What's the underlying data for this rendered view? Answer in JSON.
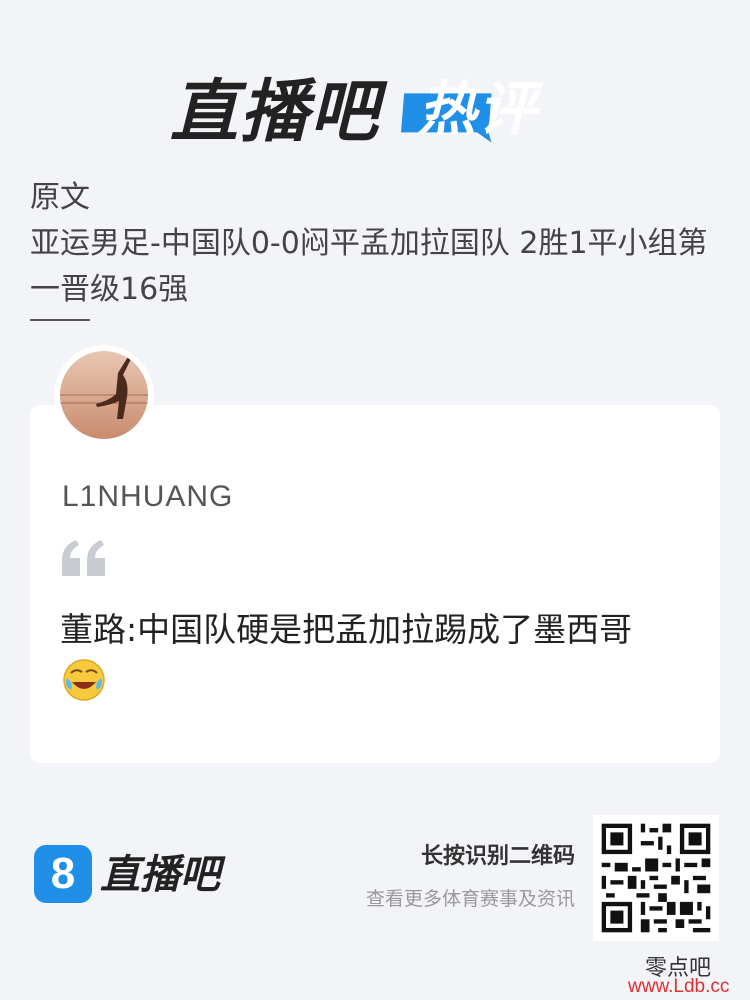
{
  "header": {
    "logo_text": "直播吧",
    "badge_text": "热评",
    "brand_blue": "#1f8fe8"
  },
  "original": {
    "title": "原文",
    "body": "亚运男足-中国队0-0闷平孟加拉国队 2胜1平小组第一晋级16强"
  },
  "comment": {
    "username": "L1NHUANG",
    "text": "董路:中国队硬是把孟加拉踢成了墨西哥",
    "emoji": "crying-laughing-emoji"
  },
  "footer": {
    "logo_number": "8",
    "logo_text": "直播吧",
    "qr_title": "长按识别二维码",
    "qr_subtitle": "查看更多体育赛事及资讯"
  },
  "watermark": {
    "line1": "零点吧",
    "line2": "www.Ldb.cc"
  }
}
